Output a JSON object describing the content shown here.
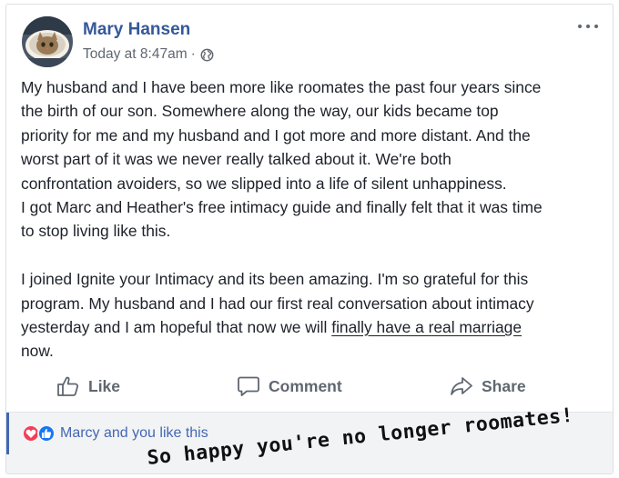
{
  "post": {
    "author": "Mary Hansen",
    "timestamp": "Today at 8:47am",
    "separator": "·",
    "privacy_icon": "globe-icon",
    "more_icon": "more-options-icon",
    "body_lines": [
      "My husband and I have been more like roomates the past four years since",
      "the birth of our son. Somewhere along the way, our kids became top",
      "priority for me and my husband and I got more and more distant. And the",
      "worst part of it was we never really talked about it. We're both",
      "confrontation avoiders, so we slipped into a life of silent unhappiness.",
      "I got Marc and Heather's free intimacy guide and finally felt that it was time",
      "to stop living like this.",
      "I joined Ignite your Intimacy and its been amazing. I'm so grateful for this",
      "program. My husband and I had our first real conversation about intimacy",
      "yesterday and I am hopeful that now we will ",
      "finally have a real marriage ",
      "now."
    ]
  },
  "actions": {
    "like_label": "Like",
    "comment_label": "Comment",
    "share_label": "Share"
  },
  "reactions": {
    "icons": [
      "love-icon",
      "like-icon"
    ],
    "text": "Marcy and you like this"
  },
  "annotation": {
    "text": "So happy you're no longer roomates!"
  },
  "colors": {
    "author": "#365899",
    "muted": "#606770",
    "link_blue": "#4267b2",
    "love_red": "#f33e58",
    "like_blue": "#1877f2"
  }
}
